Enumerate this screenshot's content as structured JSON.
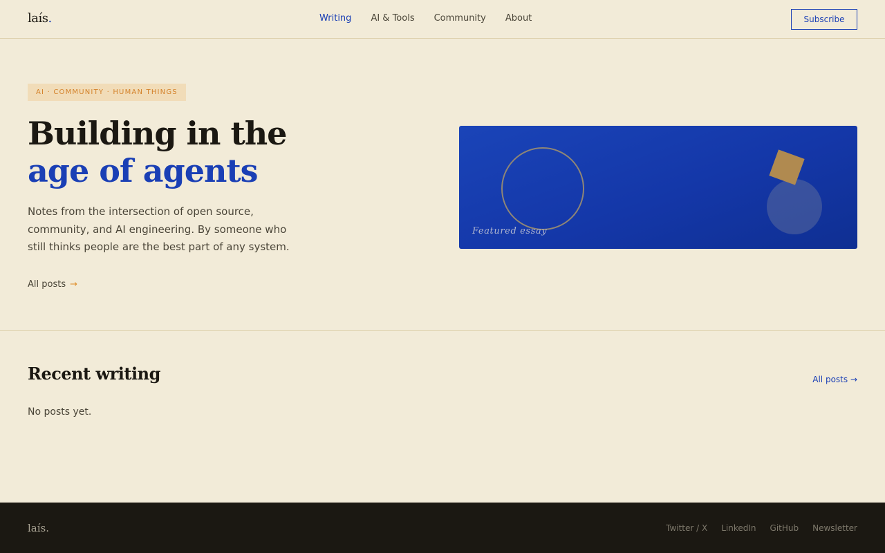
{
  "header": {
    "logo": "laís",
    "logo_dot": ".",
    "nav": [
      {
        "label": "Writing"
      },
      {
        "label": "AI & Tools"
      },
      {
        "label": "Community"
      },
      {
        "label": "About"
      }
    ],
    "subscribe": "Subscribe"
  },
  "hero": {
    "tag": "AI · Community · Human things",
    "title_line1": "Building in the",
    "title_line2": "age of agents",
    "lead": "Notes from the intersection of open source, community, and AI engineering. By someone who still thinks people are the best part of any system.",
    "all_posts": "All posts",
    "all_posts_arrow": "→",
    "feature_label": "Featured essay"
  },
  "recent": {
    "title": "Recent writing",
    "all_posts": "All posts →",
    "empty": "No posts yet."
  },
  "footer": {
    "logo": "laís.",
    "links": [
      {
        "label": "Twitter / X"
      },
      {
        "label": "LinkedIn"
      },
      {
        "label": "GitHub"
      },
      {
        "label": "Newsletter"
      }
    ]
  },
  "colors": {
    "background": "#f2ebd8",
    "accent": "#1a3fb5",
    "tag_text": "#d4822a",
    "footer_bg": "#1b1812"
  }
}
